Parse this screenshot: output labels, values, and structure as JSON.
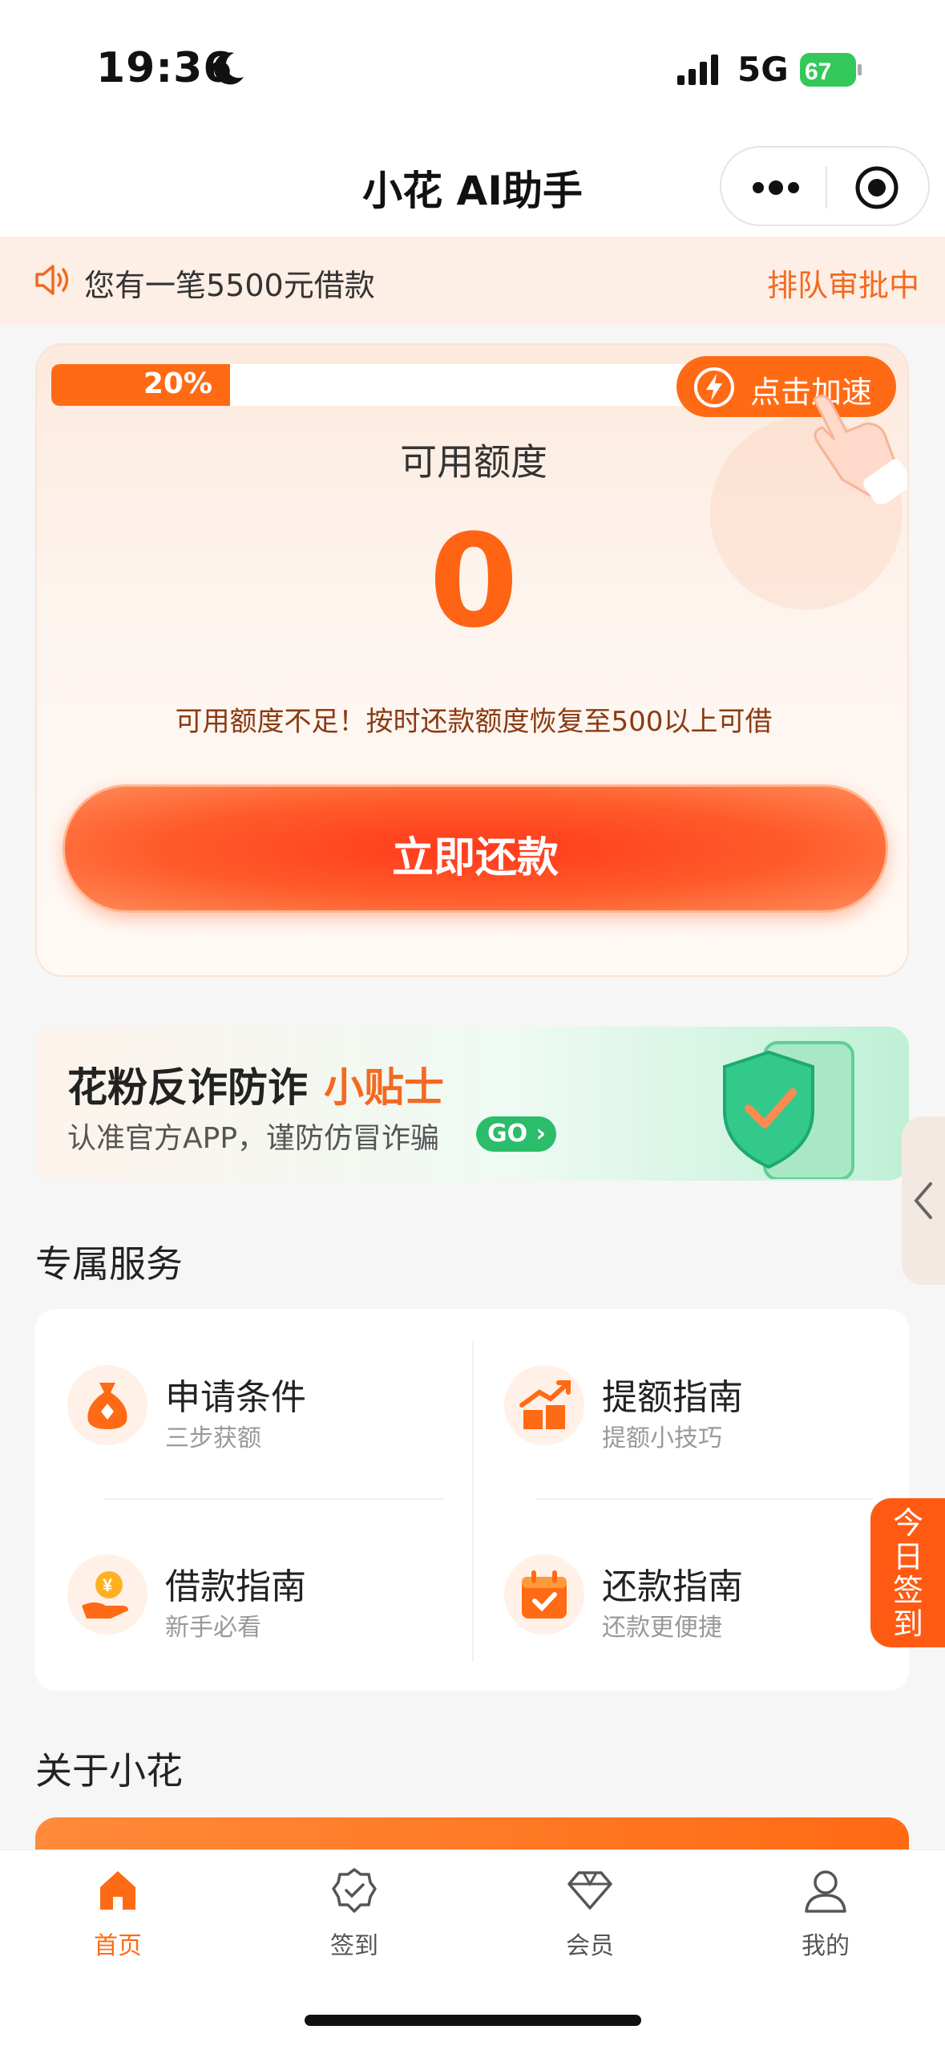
{
  "status_bar": {
    "time": "19:36",
    "network": "5G",
    "battery": "67"
  },
  "nav": {
    "title": "小花 AI助手"
  },
  "notice": {
    "message": "您有一笔5500元借款",
    "status": "排队审批中"
  },
  "credit": {
    "progress_percent": 20,
    "progress_label": "20%",
    "speed_up_label": "点击加速",
    "title": "可用额度",
    "amount": "0",
    "hint": "可用额度不足！按时还款额度恢复至500以上可借",
    "repay_button": "立即还款"
  },
  "fraud_banner": {
    "title": "花粉反诈防诈",
    "title_highlight": "小贴士",
    "subtitle": "认准官方APP，谨防仿冒诈骗",
    "go_label": "GO"
  },
  "services": {
    "section_title": "专属服务",
    "items": [
      {
        "name": "申请条件",
        "desc": "三步获额",
        "icon": "money-bag-icon"
      },
      {
        "name": "提额指南",
        "desc": "提额小技巧",
        "icon": "growth-chart-icon"
      },
      {
        "name": "借款指南",
        "desc": "新手必看",
        "icon": "yuan-coin-hand-icon"
      },
      {
        "name": "还款指南",
        "desc": "还款更便捷",
        "icon": "calendar-check-icon"
      }
    ]
  },
  "checkin_float": {
    "label": "今日签到"
  },
  "about": {
    "section_title": "关于小花"
  },
  "tabbar": {
    "items": [
      {
        "label": "首页",
        "icon": "home-icon",
        "active": true
      },
      {
        "label": "签到",
        "icon": "checkin-badge-icon",
        "active": false
      },
      {
        "label": "会员",
        "icon": "diamond-icon",
        "active": false
      },
      {
        "label": "我的",
        "icon": "user-icon",
        "active": false
      }
    ]
  },
  "colors": {
    "accent": "#ff6a14",
    "go_green": "#2bbd6a",
    "notice_bg": "#fdeee6"
  }
}
